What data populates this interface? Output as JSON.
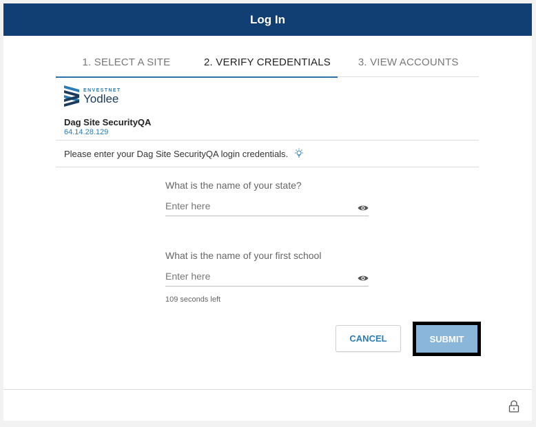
{
  "header": {
    "title": "Log In"
  },
  "steps": [
    {
      "label": "1. SELECT A SITE",
      "state": "done"
    },
    {
      "label": "2. VERIFY CREDENTIALS",
      "state": "active"
    },
    {
      "label": "3. VIEW ACCOUNTS",
      "state": "pending"
    }
  ],
  "logo": {
    "sub": "ENVESTNET",
    "main": "Yodlee"
  },
  "site": {
    "name": "Dag Site SecurityQA",
    "ip": "64.14.28.129"
  },
  "info": {
    "message": "Please enter your Dag Site SecurityQA login credentials.",
    "icon": "lightbulb-icon"
  },
  "fields": [
    {
      "label": "What is the name of your state?",
      "placeholder": "Enter here",
      "value": ""
    },
    {
      "label": "What is the name of your first school",
      "placeholder": "Enter here",
      "value": ""
    }
  ],
  "timer": "109 seconds left",
  "buttons": {
    "cancel": "CANCEL",
    "submit": "SUBMIT"
  },
  "colors": {
    "header": "#123f73",
    "accent": "#2a7bb8",
    "submit": "#8ab6d9"
  }
}
